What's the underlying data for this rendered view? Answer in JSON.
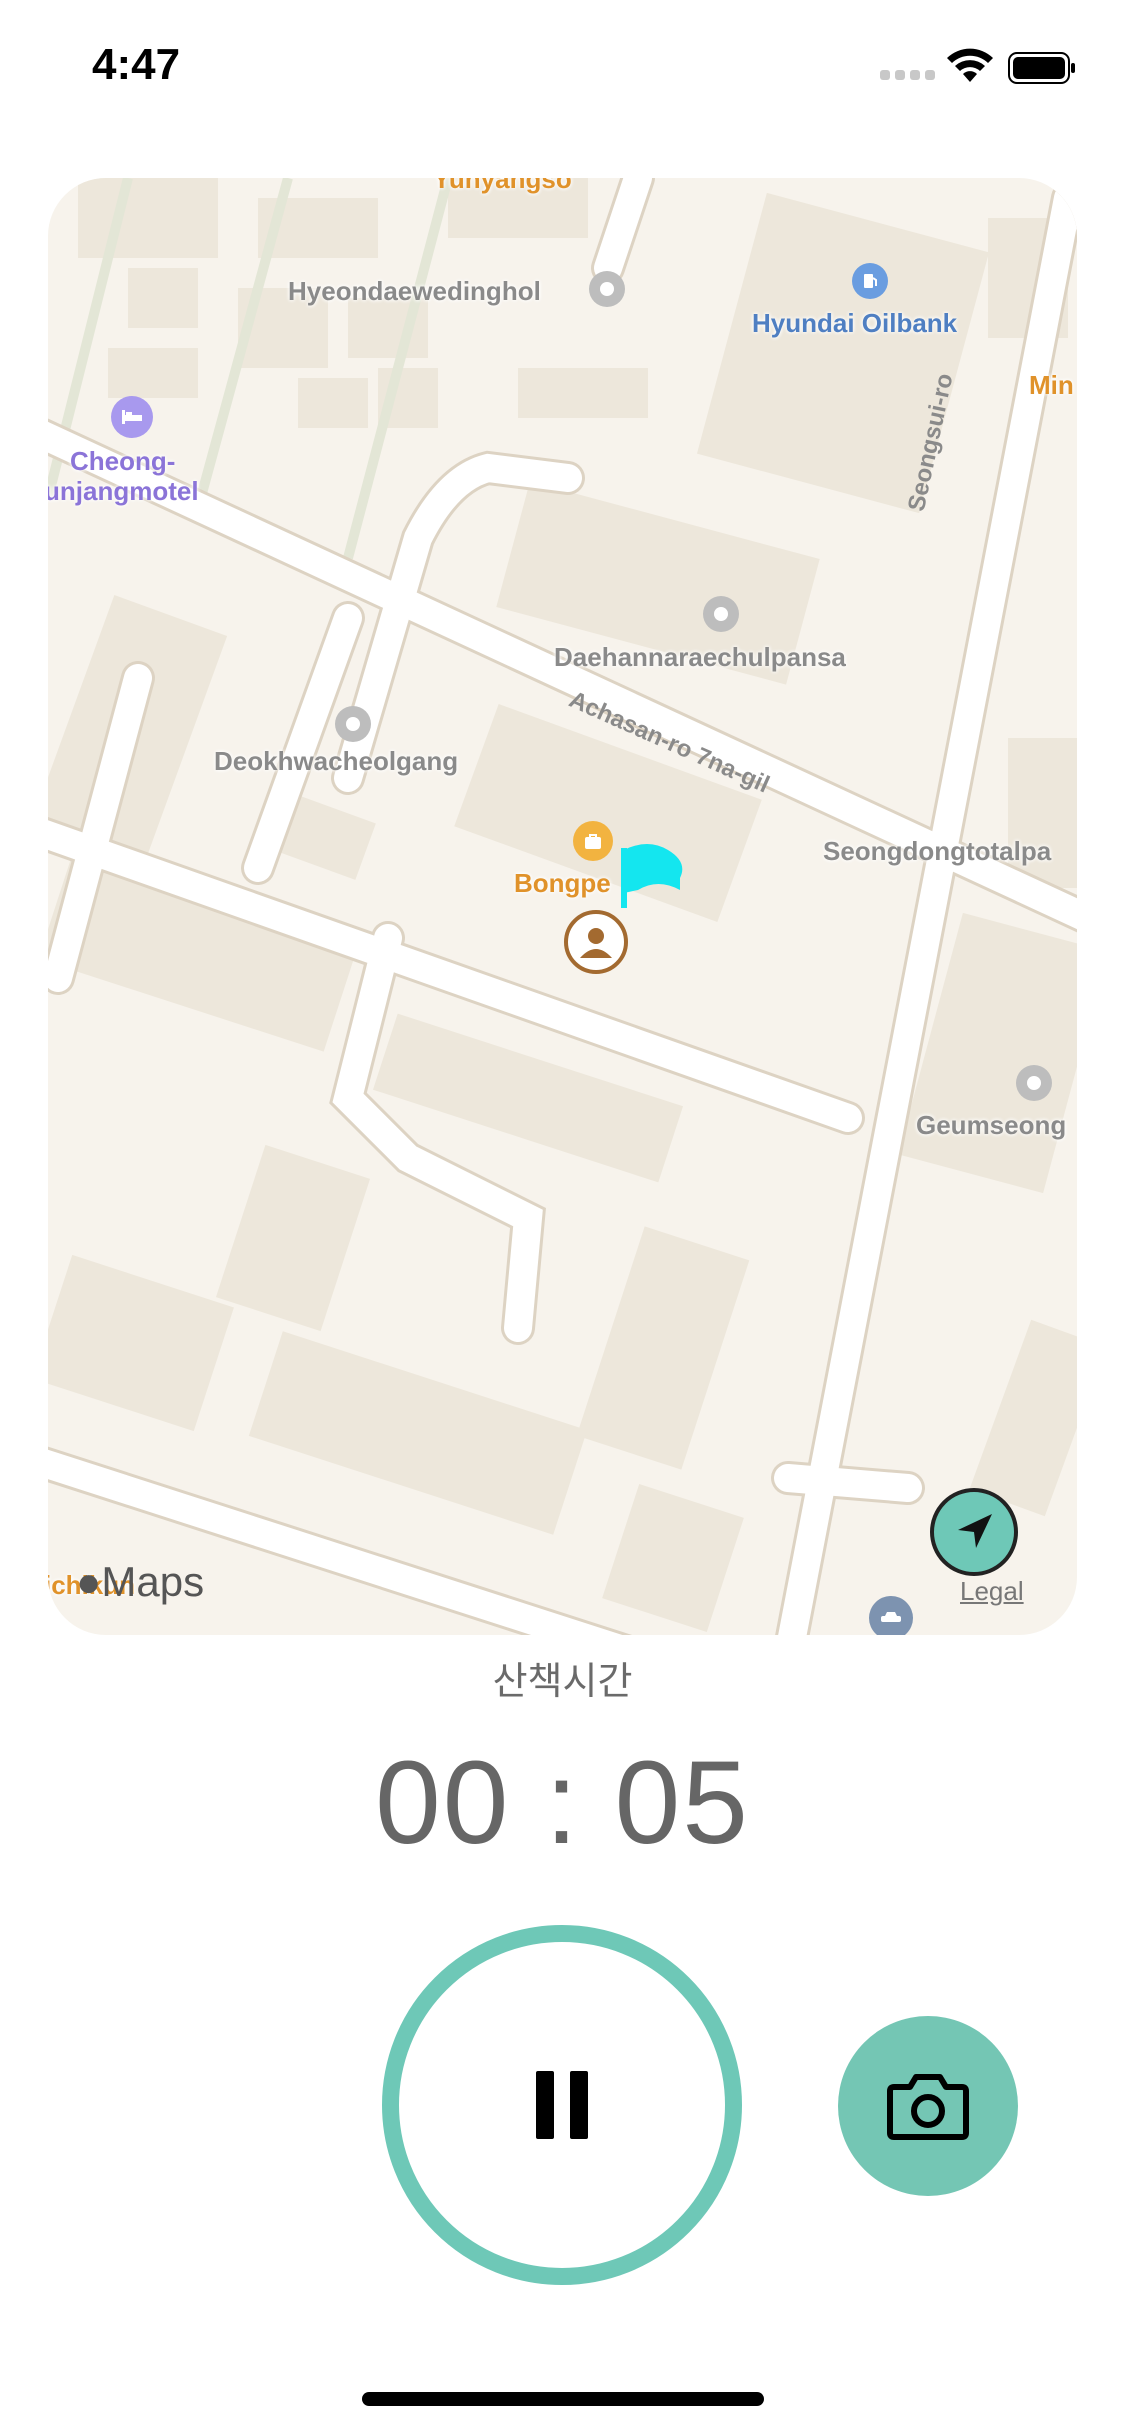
{
  "status_bar": {
    "time": "4:47"
  },
  "map": {
    "labels": {
      "top_cut": "Yunyangso",
      "wedding_hall": "Hyeondaewedinghol",
      "oilbank": "Hyundai Oilbank",
      "right_cut": "Min",
      "motel_line1": "Cheong-",
      "motel_line2": "unjangmotel",
      "road_seongsui": "Seongsui-ro",
      "daehan": "Daehannaraechulpansa",
      "road_achasan": "Achasan-ro 7na-gil",
      "deokhwa": "Deokhwacheolgang",
      "seongdong": "Seongdongtotalpa",
      "bongpe": "Bongpe",
      "geumseong": "Geumseong",
      "bottom_left": "ichikun"
    },
    "maps_logo": "Maps",
    "legal": "Legal",
    "accent_color": "#6ec8b7",
    "flag_color": "#14e6ef"
  },
  "walk": {
    "label": "산책시간",
    "timer": "00 : 05"
  },
  "controls": {
    "pause_icon": "pause-icon",
    "camera_icon": "camera-icon"
  }
}
